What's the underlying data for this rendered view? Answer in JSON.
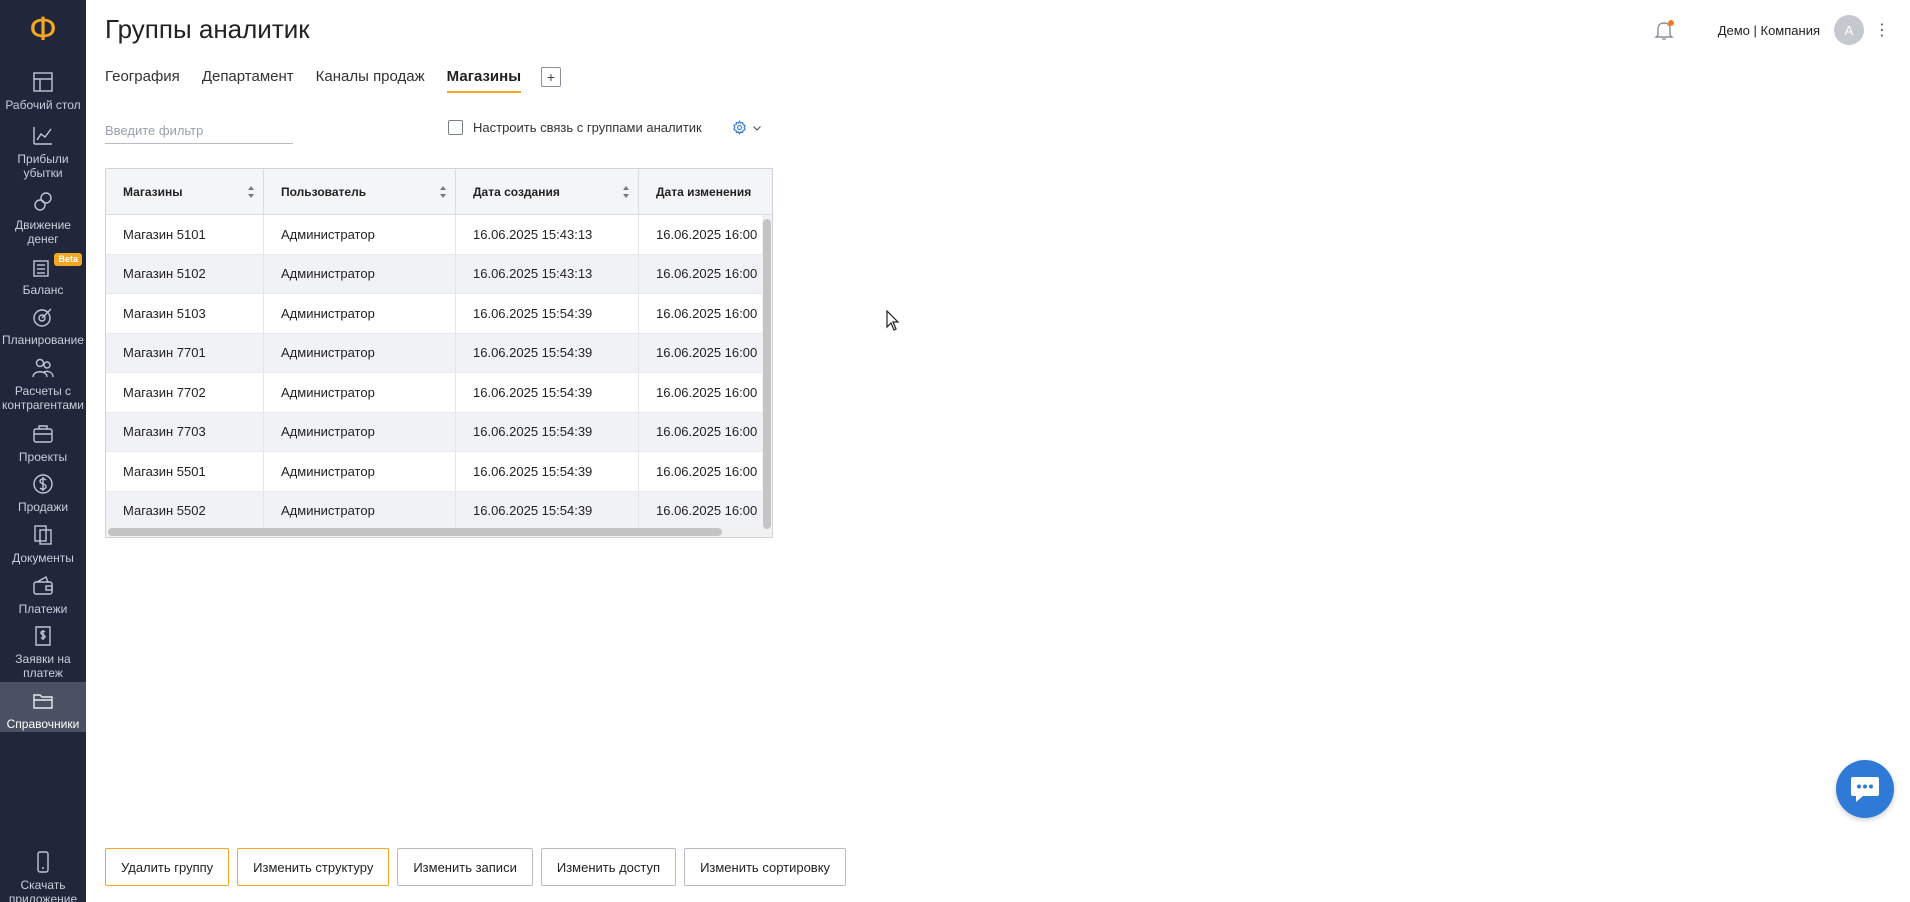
{
  "sidebar": {
    "logo": "Ф",
    "items": [
      {
        "label": "Рабочий стол",
        "icon": "dashboard-icon"
      },
      {
        "label": "Прибыли убытки",
        "icon": "chart-icon"
      },
      {
        "label": "Движение денег",
        "icon": "coins-icon"
      },
      {
        "label": "Баланс",
        "icon": "balance-icon",
        "badge": "Beta"
      },
      {
        "label": "Планирование",
        "icon": "target-icon"
      },
      {
        "label": "Расчеты с контрагентами",
        "icon": "partners-icon"
      },
      {
        "label": "Проекты",
        "icon": "briefcase-icon"
      },
      {
        "label": "Продажи",
        "icon": "dollar-icon"
      },
      {
        "label": "Документы",
        "icon": "documents-icon"
      },
      {
        "label": "Платежи",
        "icon": "wallet-icon"
      },
      {
        "label": "Заявки на платеж",
        "icon": "request-icon"
      },
      {
        "label": "Справочники",
        "icon": "folder-icon"
      }
    ],
    "download": {
      "label": "Скачать приложение",
      "icon": "phone-icon"
    }
  },
  "header": {
    "title": "Группы аналитик",
    "company": "Демо | Компания",
    "avatar": "А"
  },
  "tabs": [
    {
      "label": "География"
    },
    {
      "label": "Департамент"
    },
    {
      "label": "Каналы продаж"
    },
    {
      "label": "Магазины"
    }
  ],
  "filter": {
    "placeholder": "Введите фильтр",
    "link_label": "Настроить связь с группами аналитик"
  },
  "table": {
    "columns": [
      "Магазины",
      "Пользователь",
      "Дата создания",
      "Дата изменения"
    ],
    "rows": [
      [
        "Магазин 5101",
        "Администратор",
        "16.06.2025 15:43:13",
        "16.06.2025 16:00"
      ],
      [
        "Магазин 5102",
        "Администратор",
        "16.06.2025 15:43:13",
        "16.06.2025 16:00"
      ],
      [
        "Магазин 5103",
        "Администратор",
        "16.06.2025 15:54:39",
        "16.06.2025 16:00"
      ],
      [
        "Магазин 7701",
        "Администратор",
        "16.06.2025 15:54:39",
        "16.06.2025 16:00"
      ],
      [
        "Магазин 7702",
        "Администратор",
        "16.06.2025 15:54:39",
        "16.06.2025 16:00"
      ],
      [
        "Магазин 7703",
        "Администратор",
        "16.06.2025 15:54:39",
        "16.06.2025 16:00"
      ],
      [
        "Магазин 5501",
        "Администратор",
        "16.06.2025 15:54:39",
        "16.06.2025 16:00"
      ],
      [
        "Магазин 5502",
        "Администратор",
        "16.06.2025 15:54:39",
        "16.06.2025 16:00"
      ]
    ]
  },
  "buttons": {
    "delete_group": "Удалить группу",
    "edit_structure": "Изменить структуру",
    "edit_records": "Изменить записи",
    "edit_access": "Изменить доступ",
    "edit_sorting": "Изменить сортировку"
  },
  "colors": {
    "sidebar_bg": "#20273a",
    "accent": "#f5a623",
    "chat_button": "#2f7ad7"
  }
}
